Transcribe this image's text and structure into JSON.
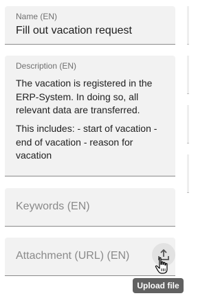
{
  "name_field": {
    "label": "Name (EN)",
    "value": "Fill out vacation request"
  },
  "description_field": {
    "label": "Description (EN)",
    "paragraph_1": "The vacation is registered in the ERP-System. In doing so, all relevant data are transferred.",
    "paragraph_2": "This includes: - start of vacation - end of vacation - reason for vacation"
  },
  "keywords_field": {
    "placeholder": "Keywords (EN)"
  },
  "attachment_field": {
    "placeholder": "Attachment (URL) (EN)",
    "upload_icon": "upload-icon"
  },
  "tooltip": {
    "text": "Upload file"
  },
  "cursor": "hand-pointer-icon",
  "colors": {
    "field_background": "#f2f2f2",
    "tooltip_background": "#616161",
    "label": "#6f6f6f",
    "placeholder": "#8a8a8a"
  }
}
